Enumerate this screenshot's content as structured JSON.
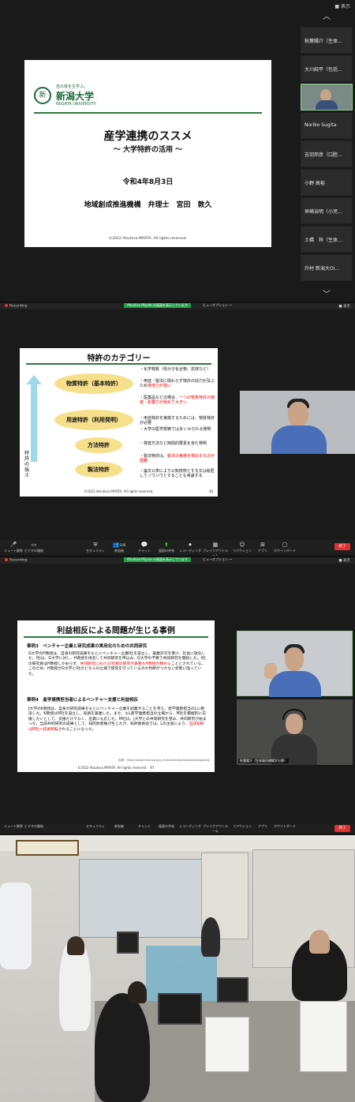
{
  "panel1": {
    "top_right": "■ 表示",
    "slide": {
      "logo_tagline": "自の後を生学ぶ。",
      "logo_name": "新潟大学",
      "logo_english": "NIIGATA UNIVERSITY",
      "title": "産学連携のススメ",
      "subtitle": "～ 大学特許の活用 ～",
      "date": "令和4年8月3日",
      "org": "地域創成推進機構　弁理士　宮田　敦久",
      "copyright": "©2022 Atsuhisa MIYATA. All rights reserved."
    },
    "participants": [
      "秋葉陽介（生体...",
      "大川純平（包括...",
      "Noriko Sugita",
      "吉羽邦彦（口腔...",
      "小野 高裕",
      "早崎治明（小児...",
      "土橋　梓（生体...",
      "升村 新潟大OI..."
    ],
    "chevron_up": "︿",
    "chevron_down": "﹀"
  },
  "panel2": {
    "recording": "Recording",
    "share_banner": "Atsuhisa Miyata の画面を表示しています",
    "view_options": "ビューオプション ～",
    "top_right": "■ 表示",
    "slide": {
      "title": "特許のカテゴリー",
      "vertical_label": "特許の強さ",
      "ovals": [
        "物質特許（基本特許）",
        "用途特許（利用発明）",
        "方法特許",
        "製法特許"
      ],
      "bullets": [
        {
          "text": "化学物質（低分子化合物、抗体など）",
          "red": ""
        },
        {
          "text": "用途・製法に関わらず特許の効力が及ぶため",
          "red": "排他力が強い"
        },
        {
          "text": "医薬品などの場合、",
          "red": "一つの物質特許の価値・影響力が極めて大きい"
        },
        {
          "text": "用途特許を実施するためには、物質特許が必要",
          "red": ""
        },
        {
          "text": "大学の医学部等では多くみられる発明",
          "red": ""
        },
        {
          "text": "検査方法など時間的要素を含む発明",
          "red": ""
        },
        {
          "text": "製法特許は、",
          "red": "製法の実施を検出するのが困難"
        },
        {
          "text": "論文公表により公知技術とする又は秘匿してノウハウとすることも考慮する",
          "red": ""
        }
      ],
      "copyright": "©2022 Atsuhisa MIYATA. All rights reserved.",
      "page": "34"
    },
    "toolbar": [
      {
        "icon": "🎤",
        "label": "ミュート解除"
      },
      {
        "icon": "▭",
        "label": "ビデオの開始"
      },
      {
        "icon": "⛨",
        "label": "セキュリティ"
      },
      {
        "icon": "👥",
        "label": "参加者"
      },
      {
        "icon": "💬",
        "label": "チャット"
      },
      {
        "icon": "⬆",
        "label": "画面の共有"
      },
      {
        "icon": "⏺",
        "label": "レコーディング"
      },
      {
        "icon": "▦",
        "label": "ブレイクアウトルーム"
      },
      {
        "icon": "☺",
        "label": "リアクション"
      },
      {
        "icon": "⊞",
        "label": "アプリ"
      },
      {
        "icon": "▢",
        "label": "ホワイトボード"
      }
    ],
    "participants_count": "106",
    "end_label": "終了"
  },
  "panel3": {
    "recording": "Recording",
    "share_banner": "Atsuhisa Miyata の画面を表示しています",
    "view_options": "ビューオプション ～",
    "top_right": "■ 表示",
    "slide": {
      "title": "利益相反による問題が生じる事例",
      "case3_heading": "事例3　ベンチャー企業と研究成果の実用化のための共同研究",
      "case3_text_a": "G大学のH教授は、自身の研究成果をもとにベンチャー企業I社を設立し、兼業許可を受け、社長に就任した。I社は、G大学に対し、H教授を指名して共同研究を申込み、G大学の予算で共同研究を開始した。I社の研究員はH教授しかおらず、",
      "case3_text_red": "共同研究におけるI社側の研究代表者もH教授が務める",
      "case3_text_b": "こととされている。このため、H教授がG大学とI社のどちらの立場で研究を行っているのか判断がつかない状態に陥っていた。",
      "case4_heading": "事例4　産学連携担当者によるベンチャー支援と利益相反",
      "case4_text_a": "J大学のK教授は、自身の研究成果をもとにベンチャー企業を創業することを考え、産学連携担当のLに相談した。K教授はM社を設立し、役員を兼業した。また、もL産学連携担当の立場から、M社を積極的に応援したいとして、支援だけでなく、出資にも応じた。M社は、J大学との共同研究を望み、共同研究が始まった。当該共同研究の成果として、知的財産権が生じたが、知財委員会では、Lの主張により、",
      "case4_text_red": "当該知財はM社へ技術移転",
      "case4_text_b": "されることになった。",
      "source": "出典：https://www.mext.go.jp/a_menu/shinkou/sangaku/sangakub/",
      "copyright": "©2022 Atsuhisa MIYATA. All rights reserved.",
      "page": "67"
    },
    "cam_caption": "秋葉陽介（生体歯科補綴学分野）",
    "toolbar": [
      {
        "icon": "🎤",
        "label": "ミュート解除"
      },
      {
        "icon": "▭",
        "label": "ビデオの開始"
      },
      {
        "icon": "⛨",
        "label": "セキュリティ"
      },
      {
        "icon": "👥",
        "label": "参加者"
      },
      {
        "icon": "💬",
        "label": "チャット"
      },
      {
        "icon": "⬆",
        "label": "画面の共有"
      },
      {
        "icon": "⏺",
        "label": "レコーディング"
      },
      {
        "icon": "▦",
        "label": "ブレイクアウトルーム"
      },
      {
        "icon": "☺",
        "label": "リアクション"
      },
      {
        "icon": "⊞",
        "label": "アプリ"
      },
      {
        "icon": "▢",
        "label": "ホワイトボード"
      }
    ],
    "end_label": "終了"
  }
}
